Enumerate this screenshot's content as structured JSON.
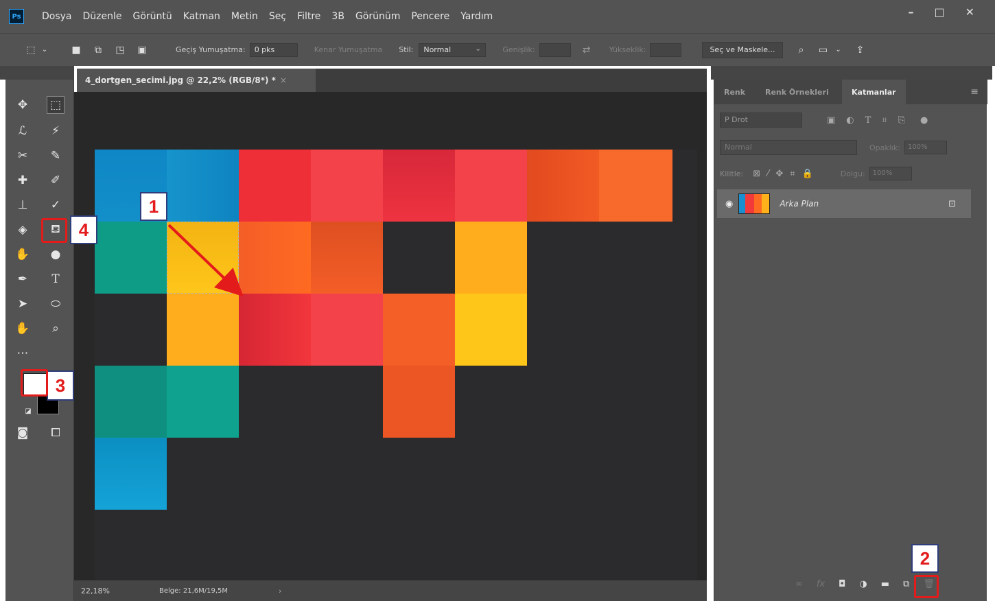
{
  "app": {
    "logo_text": "Ps"
  },
  "menu": {
    "items": [
      "Dosya",
      "Düzenle",
      "Görüntü",
      "Katman",
      "Metin",
      "Seç",
      "Filtre",
      "3B",
      "Görünüm",
      "Pencere",
      "Yardım"
    ]
  },
  "window_controls": {
    "minimize": "–",
    "maximize": "□",
    "close": "✕"
  },
  "options_bar": {
    "feather_label": "Geçiş Yumuşatma:",
    "feather_value": "0 pks",
    "antialias_label": "Kenar Yumuşatma",
    "style_label": "Stil:",
    "style_value": "Normal",
    "width_label": "Genişlik:",
    "height_label": "Yükseklik:",
    "select_mask_button": "Seç ve Maskele..."
  },
  "document": {
    "tab_title": "4_dortgen_secimi.jpg @ 22,2% (RGB/8*) *",
    "close_glyph": "×"
  },
  "status_bar": {
    "zoom": "22,18%",
    "doc_info": "Belge: 21,6M/19,5M"
  },
  "right_panel": {
    "tabs": [
      "Renk",
      "Renk Örnekleri",
      "Katmanlar"
    ],
    "active_tab": "Katmanlar",
    "search_placeholder": "Ρ Drot",
    "blend_mode": "Normal",
    "opacity_label": "Opaklık:",
    "opacity_value": "100%",
    "lock_label": "Kilitle:",
    "fill_label": "Dolgu:",
    "fill_value": "100%",
    "layers": [
      {
        "name": "Arka Plan",
        "visible": true,
        "locked": true
      }
    ]
  },
  "colors": {
    "foreground": "#ffffff",
    "background": "#000000",
    "annotation_red": "#e31b1b",
    "teal": "#0e9a88",
    "blue": "#128fc8",
    "red": "#f2363c",
    "orange": "#f45e27",
    "amber": "#ffad1c",
    "yellow": "#ffc61a"
  },
  "annotations": [
    "1",
    "2",
    "3",
    "4"
  ]
}
